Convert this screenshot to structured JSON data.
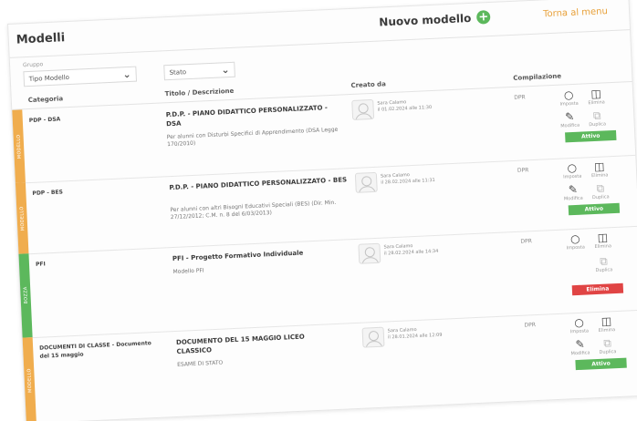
{
  "header": {
    "title": "Modelli",
    "new_model_label": "Nuovo modello",
    "back_label": "Torna al menu"
  },
  "filters": {
    "label": "Gruppo",
    "category_select": "Tipo Modello",
    "status_select": "Stato"
  },
  "table": {
    "columns": [
      "Categoria",
      "Titolo / Descrizione",
      "Creato da",
      "Compilazione"
    ],
    "rows": [
      {
        "tag": "MODELLO",
        "tag_color": "#f0ad4e",
        "category": "PDP - DSA",
        "title": "P.D.P. - PIANO DIDATTICO PERSONALIZZATO - DSA",
        "description": "Per alunni con Disturbi Specifici di Apprendimento (DSA Legge 170/2010)",
        "creator_name": "Sara Calamo",
        "creator_date": "il 01.02.2024 alle 11:30",
        "compilation": "DPR",
        "actions": [
          "Imposta",
          "Elimina",
          "Modifica",
          "Duplica"
        ],
        "status": "Attivo"
      },
      {
        "tag": "MODELLO",
        "tag_color": "#f0ad4e",
        "category": "PDP - BES",
        "title": "P.D.P. - PIANO DIDATTICO PERSONALIZZATO - BES",
        "description": "Per alunni con altri Bisogni Educativi Speciali (BES) (Dir. Min. 27/12/2012; C.M. n. 8 del 6/03/2013)",
        "creator_name": "Sara Calamo",
        "creator_date": "il 28.02.2024 alle 11:31",
        "compilation": "DPR",
        "actions": [
          "Imposta",
          "Elimina",
          "Modifica",
          "Duplica"
        ],
        "status": "Attivo"
      },
      {
        "tag": "BOZZA",
        "tag_color": "#5cb85c",
        "category": "PFI",
        "title": "PFI - Progetto Formativo Individuale",
        "description": "Modello PFI",
        "creator_name": "Sara Calamo",
        "creator_date": "il 28.02.2024 alle 14:34",
        "compilation": "DPR",
        "actions": [
          "Imposta",
          "Elimina",
          "Duplica"
        ],
        "status": "Elimina"
      },
      {
        "tag": "MODELLO",
        "tag_color": "#f0ad4e",
        "category": "DOCUMENTI DI CLASSE - Documento del 15 maggio",
        "title": "DOCUMENTO DEL 15 MAGGIO LICEO CLASSICO",
        "description": "ESAME DI STATO",
        "creator_name": "Sara Calamo",
        "creator_date": "il 28.01.2024 alle 12:09",
        "compilation": "DPR",
        "actions": [
          "Imposta",
          "Elimina",
          "Modifica",
          "Duplica"
        ],
        "status": "Attivo"
      }
    ]
  }
}
